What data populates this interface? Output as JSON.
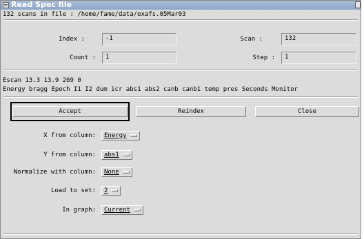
{
  "window": {
    "title": "Read Spec file"
  },
  "info_line": "132 scans in file : /home/fame/data/exafs.05Mar03",
  "index": {
    "label": "Index :",
    "value": "-1"
  },
  "scan": {
    "label": "Scan :",
    "value": "132"
  },
  "count": {
    "label": "Count :",
    "value": "1"
  },
  "step": {
    "label": "Step :",
    "value": "1"
  },
  "scan_header": "Escan 13.3 13.9 269 0",
  "columns_line": "Energy bragg Epoch I1 I2 dum icr abs1 abs2 canb canb1 temp pres Seconds Monitor",
  "buttons": {
    "accept": "Accept",
    "reindex": "Reindex",
    "close": "Close"
  },
  "options": {
    "x_col": {
      "label": "X from column:",
      "value": "Energy"
    },
    "y_col": {
      "label": "Y from column:",
      "value": "abs1"
    },
    "norm": {
      "label": "Normalize with column:",
      "value": "None"
    },
    "load_set": {
      "label": "Load to set:",
      "value": "2"
    },
    "graph": {
      "label": "In graph:",
      "value": "Current"
    }
  }
}
